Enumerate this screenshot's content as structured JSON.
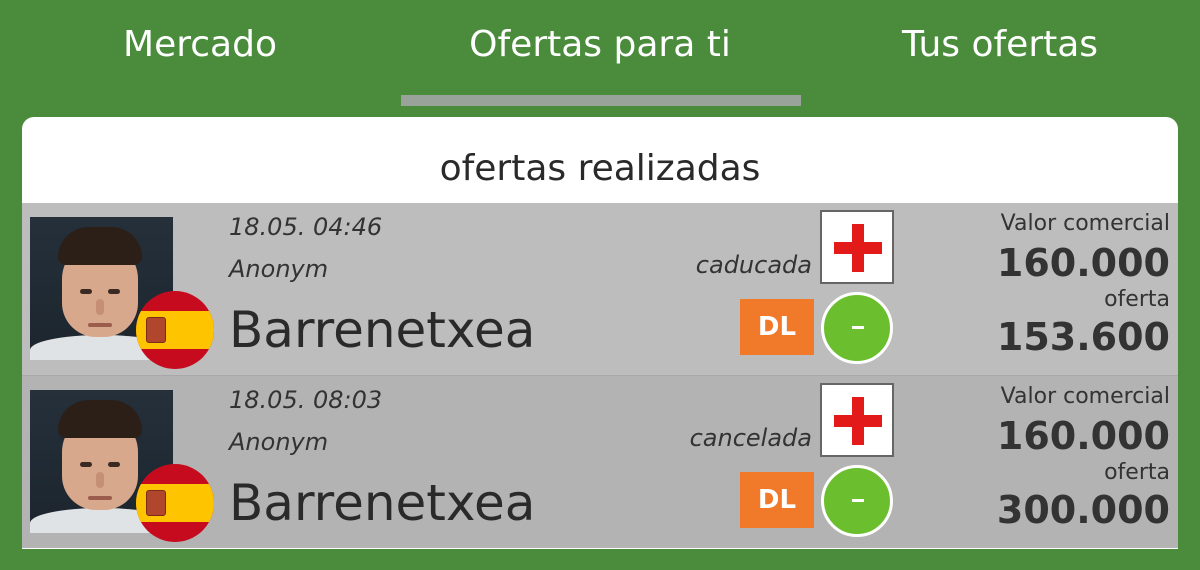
{
  "tabs": [
    {
      "label": "Mercado"
    },
    {
      "label": "Ofertas para ti"
    },
    {
      "label": "Tus ofertas"
    }
  ],
  "active_tab": "Ofertas para ti",
  "panel": {
    "title": "ofertas realizadas"
  },
  "offers": [
    {
      "date": "18.05. 04:46",
      "user": "Anonym",
      "player": "Barrenetxea",
      "status": "caducada",
      "badge": "DL",
      "market_value_label": "Valor comercial",
      "market_value": "160.000",
      "offer_label": "oferta",
      "offer_amount": "153.600"
    },
    {
      "date": "18.05. 08:03",
      "user": "Anonym",
      "player": "Barrenetxea",
      "status": "cancelada",
      "badge": "DL",
      "market_value_label": "Valor comercial",
      "market_value": "160.000",
      "offer_label": "oferta",
      "offer_amount": "300.000"
    }
  ],
  "colors": {
    "background": "#4a8c3c",
    "badge": "#f07a2a",
    "minus_button": "#6bbf2e",
    "plus_icon": "#e21a1a"
  },
  "icons": {
    "add": "plus-icon",
    "remove": "minus-icon",
    "flag": "spain-flag-icon"
  }
}
